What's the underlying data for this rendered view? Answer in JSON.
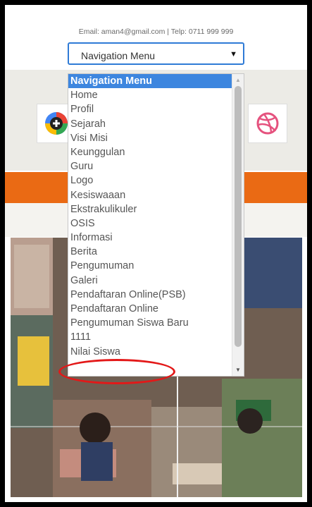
{
  "header": {
    "contact": "Email: aman4@gmail.com | Telp: 0711 999 999"
  },
  "nav_select": {
    "selected": "Navigation Menu",
    "arrow": "▼"
  },
  "dropdown": {
    "options": [
      "Navigation Menu",
      "Home",
      "Profil",
      "Sejarah",
      "Visi Misi",
      "Keunggulan",
      "Guru",
      "Logo",
      "Kesiswaaan",
      "Ekstrakulikuler",
      "OSIS",
      "Informasi",
      "Berita",
      "Pengumuman",
      "Galeri",
      "Pendaftaran Online(PSB)",
      "Pendaftaran Online",
      "Pengumuman Siswa Baru",
      "1111",
      "Nilai Siswa"
    ],
    "selected_index": 0
  },
  "social_icons": [
    "google-plus-icon",
    "dribbble-icon"
  ],
  "colors": {
    "accent_bar": "#ea6a14",
    "selection": "#3d86df",
    "highlight_circle": "#e31818"
  }
}
